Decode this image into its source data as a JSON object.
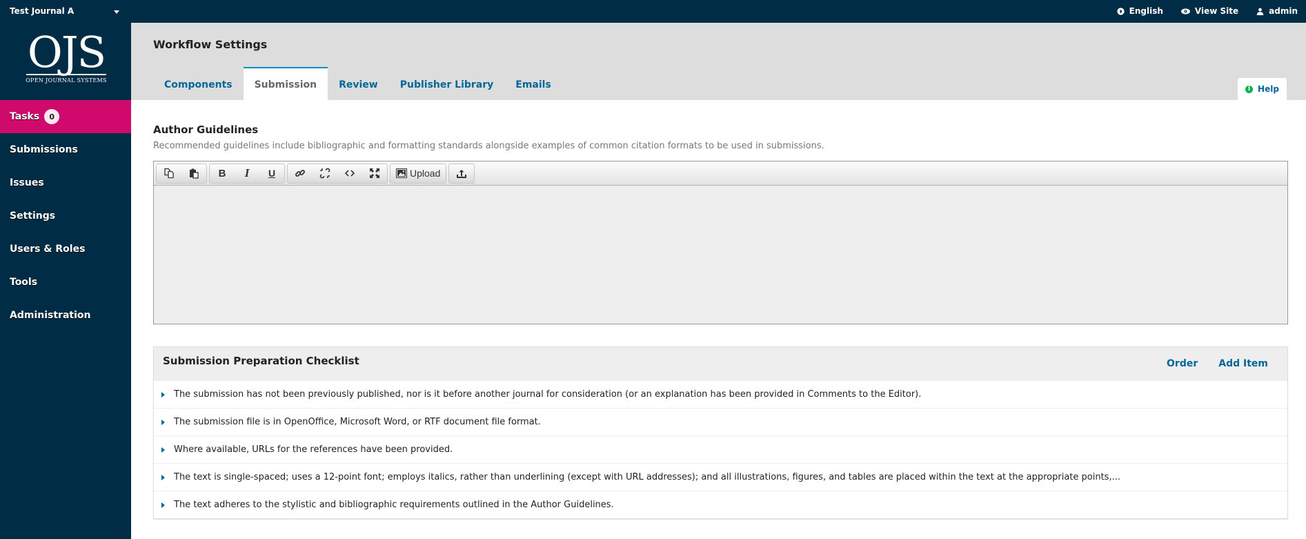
{
  "topbar": {
    "context": "Test Journal A",
    "links": [
      {
        "label": "English",
        "icon": "globe-icon"
      },
      {
        "label": "View Site",
        "icon": "eye-icon"
      },
      {
        "label": "admin",
        "icon": "user-icon"
      }
    ]
  },
  "logo": {
    "big": "OJS",
    "small": "OPEN JOURNAL SYSTEMS"
  },
  "sidebar": {
    "items": [
      {
        "label": "Tasks",
        "badge": "0",
        "active": true
      },
      {
        "label": "Submissions"
      },
      {
        "label": "Issues"
      },
      {
        "label": "Settings"
      },
      {
        "label": "Users & Roles"
      },
      {
        "label": "Tools"
      },
      {
        "label": "Administration"
      }
    ]
  },
  "header": {
    "title": "Workflow Settings",
    "tabs": [
      {
        "label": "Components"
      },
      {
        "label": "Submission",
        "active": true
      },
      {
        "label": "Review"
      },
      {
        "label": "Publisher Library"
      },
      {
        "label": "Emails"
      }
    ],
    "help": "Help"
  },
  "author_guidelines": {
    "title": "Author Guidelines",
    "description": "Recommended guidelines include bibliographic and formatting standards alongside examples of common citation formats to be used in submissions.",
    "toolbar": {
      "buttons": [
        "copy",
        "paste",
        "bold",
        "italic",
        "underline",
        "link",
        "unlink",
        "code",
        "fullscreen",
        "upload",
        "import"
      ],
      "upload_label": "Upload"
    },
    "content": ""
  },
  "checklist": {
    "title": "Submission Preparation Checklist",
    "order_label": "Order",
    "add_label": "Add Item",
    "items": [
      "The submission has not been previously published, nor is it before another journal for consideration (or an explanation has been provided in Comments to the Editor).",
      "The submission file is in OpenOffice, Microsoft Word, or RTF document file format.",
      "Where available, URLs for the references have been provided.",
      "The text is single-spaced; uses a 12-point font; employs italics, rather than underlining (except with URL addresses); and all illustrations, figures, and tables are placed within the text at the appropriate points,...",
      "The text adheres to the stylistic and bibliographic requirements outlined in the Author Guidelines."
    ]
  },
  "colors": {
    "nav_bg": "#002c45",
    "accent_pink": "#d00a6c",
    "link_blue": "#006798",
    "tab_active_border": "#008acb",
    "help_green": "#00b24e"
  }
}
